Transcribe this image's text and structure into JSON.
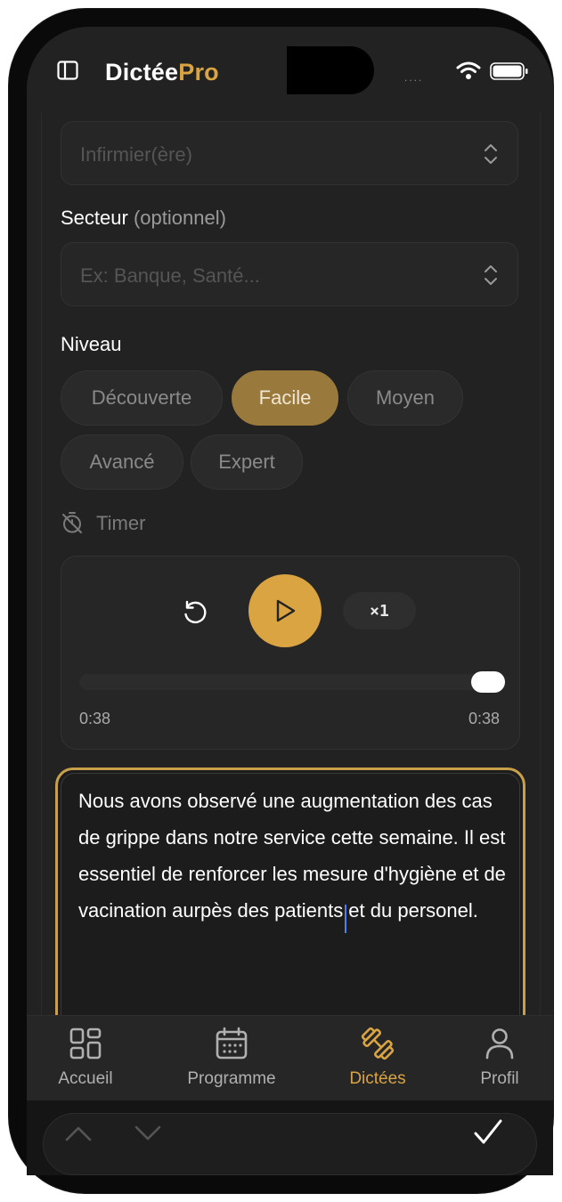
{
  "app": {
    "brand_part1": "Dictée",
    "brand_part2": "Pro",
    "status_dots": "...."
  },
  "form": {
    "profession_placeholder": "Infirmier(ère)",
    "sector_label": "Secteur",
    "sector_optional": "(optionnel)",
    "sector_placeholder": "Ex: Banque, Santé...",
    "level_label": "Niveau",
    "levels": [
      "Découverte",
      "Facile",
      "Moyen",
      "Avancé",
      "Expert"
    ],
    "selected_level": "Facile",
    "timer_label": "Timer"
  },
  "player": {
    "speed_label": "×1",
    "time_current": "0:38",
    "time_total": "0:38",
    "progress": 1.0
  },
  "editor": {
    "text": "Nous avons observé une augmentation des cas de grippe dans notre service cette semaine. Il est essentiel de renforcer les mesure d'hygiène et de vacination aurpès des patients et du personel."
  },
  "tabs": [
    {
      "label": "Accueil",
      "icon": "grid-icon",
      "active": false
    },
    {
      "label": "Programme",
      "icon": "calendar-icon",
      "active": false
    },
    {
      "label": "Dictées",
      "icon": "dumbbell-icon",
      "active": true
    },
    {
      "label": "Profil",
      "icon": "user-icon",
      "active": false
    }
  ],
  "colors": {
    "accent": "#d9a441",
    "background": "#222222",
    "chip_active": "#9a7a3c"
  }
}
